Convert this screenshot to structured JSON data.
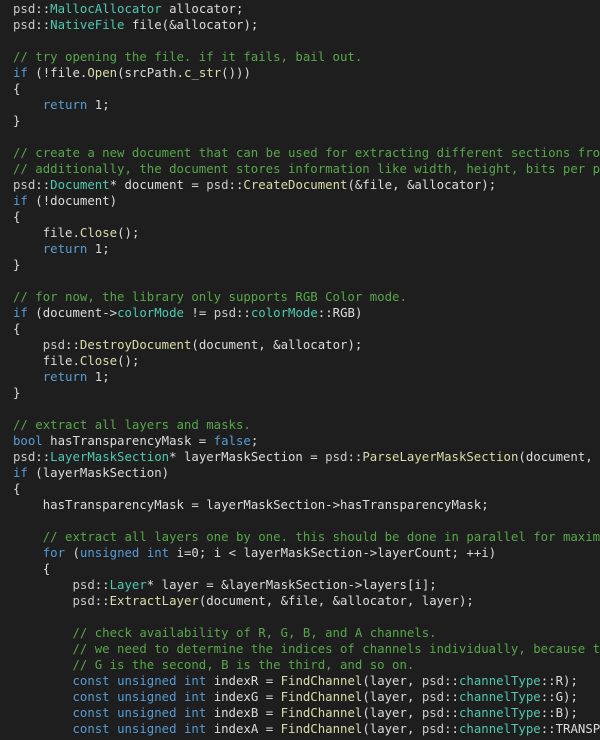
{
  "colors": {
    "background": "#1e1e1e",
    "text": "#dcdcdc",
    "keyword": "#569cd6",
    "comment": "#57a64a",
    "namespace": "#c8c8c8"
  },
  "lines": [
    "psd::MallocAllocator allocator;",
    "psd::NativeFile file(&allocator);",
    "",
    "// try opening the file. if it fails, bail out.",
    "if (!file.Open(srcPath.c_str()))",
    "{",
    "    return 1;",
    "}",
    "",
    "// create a new document that can be used for extracting different sections from the",
    "// additionally, the document stores information like width, height, bits per pixel,",
    "psd::Document* document = psd::CreateDocument(&file, &allocator);",
    "if (!document)",
    "{",
    "    file.Close();",
    "    return 1;",
    "}",
    "",
    "// for now, the library only supports RGB Color mode.",
    "if (document->colorMode != psd::colorMode::RGB)",
    "{",
    "    psd::DestroyDocument(document, &allocator);",
    "    file.Close();",
    "    return 1;",
    "}",
    "",
    "// extract all layers and masks.",
    "bool hasTransparencyMask = false;",
    "psd::LayerMaskSection* layerMaskSection = psd::ParseLayerMaskSection(document, &file",
    "if (layerMaskSection)",
    "{",
    "    hasTransparencyMask = layerMaskSection->hasTransparencyMask;",
    "",
    "    // extract all layers one by one. this should be done in parallel for maximum ef",
    "    for (unsigned int i=0; i < layerMaskSection->layerCount; ++i)",
    "    {",
    "        psd::Layer* layer = &layerMaskSection->layers[i];",
    "        psd::ExtractLayer(document, &file, &allocator, layer);",
    "",
    "        // check availability of R, G, B, and A channels.",
    "        // we need to determine the indices of channels individually, because there",
    "        // G is the second, B is the third, and so on.",
    "        const unsigned int indexR = FindChannel(layer, psd::channelType::R);",
    "        const unsigned int indexG = FindChannel(layer, psd::channelType::G);",
    "        const unsigned int indexB = FindChannel(layer, psd::channelType::B);",
    "        const unsigned int indexA = FindChannel(layer, psd::channelType::TRANSPARENC"
  ]
}
